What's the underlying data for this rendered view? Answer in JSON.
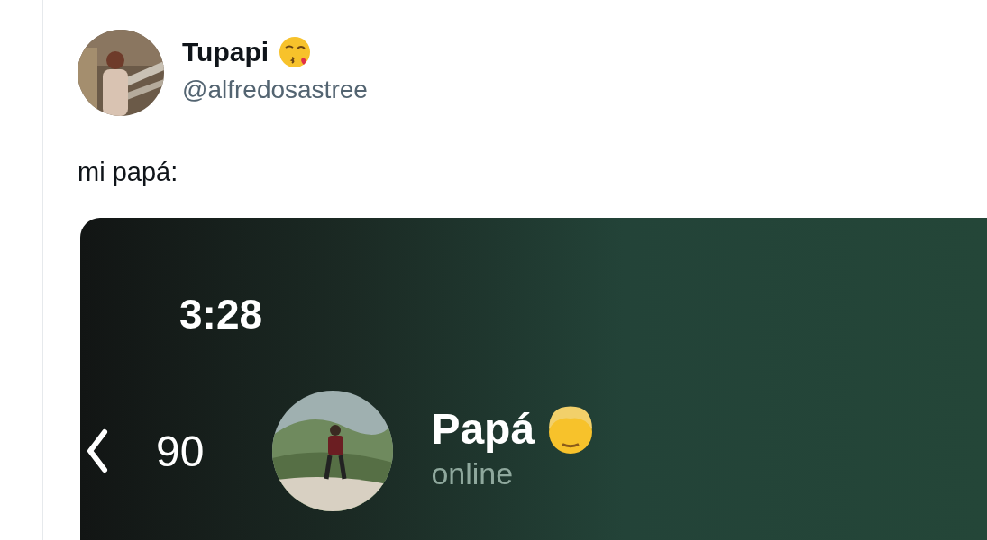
{
  "tweet": {
    "author": {
      "name": "Tupapi",
      "handle": "@alfredosastree"
    },
    "text": "mi papá:",
    "media": {
      "time": "3:28",
      "back_count": "90",
      "contact": {
        "name": "Papá",
        "status": "online"
      }
    }
  }
}
